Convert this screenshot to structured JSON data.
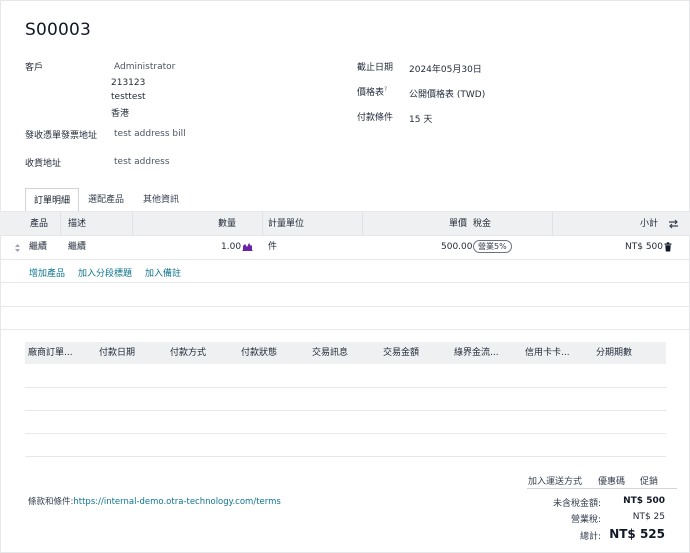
{
  "order": {
    "title": "S00003"
  },
  "customer": {
    "label": "客戶",
    "name": "Administrator",
    "line1": "213123",
    "line2": "testtest",
    "line3": "香港"
  },
  "invoice_address": {
    "label": "發收憑單發票地址",
    "value": "test address bill"
  },
  "delivery_address": {
    "label": "收貨地址",
    "value": "test address"
  },
  "expiration": {
    "label": "截止日期",
    "value": "2024年05月30日"
  },
  "pricelist": {
    "label": "價格表",
    "help": "?",
    "value": "公開價格表 (TWD)"
  },
  "payment_terms": {
    "label": "付款條件",
    "value": "15 天"
  },
  "tabs": [
    {
      "label": "訂單明細",
      "active": true
    },
    {
      "label": "選配產品",
      "active": false
    },
    {
      "label": "其他資訊",
      "active": false
    }
  ],
  "lines_table": {
    "headers": {
      "product": "產品",
      "description": "描述",
      "quantity": "數量",
      "uom": "計量單位",
      "unit_price": "單價",
      "taxes": "稅金",
      "subtotal": "小計"
    },
    "rows": [
      {
        "product": "繼續",
        "description": "繼續",
        "quantity": "1.00",
        "uom": "件",
        "unit_price": "500.00",
        "tax": "營業5%",
        "subtotal": "NT$ 500"
      }
    ],
    "actions": {
      "add_product": "增加產品",
      "add_section": "加入分段標題",
      "add_note": "加入備註"
    }
  },
  "payments_table": {
    "headers": [
      "廠商訂單...",
      "付款日期",
      "付款方式",
      "付款狀態",
      "交易訊息",
      "交易金額",
      "綠界金流...",
      "信用卡卡...",
      "分期期數"
    ]
  },
  "footer_actions": {
    "add_shipping": "加入運送方式",
    "coupon": "優惠碼",
    "promotions": "促銷"
  },
  "terms": {
    "label": "條款和條件:",
    "url": "https://internal-demo.otra-technology.com/terms"
  },
  "totals": {
    "untaxed_label": "未含稅金額:",
    "untaxed_value": "NT$ 500",
    "tax_label": "營業稅:",
    "tax_value": "NT$ 25",
    "total_label": "總計:",
    "total_value": "NT$ 525"
  },
  "colors": {
    "accent": "#0e7490",
    "header_bg": "#eef0f2",
    "border": "#e5e7eb"
  },
  "icons": {
    "drag": "drag-handle-icon",
    "forecast": "bar-chart-icon",
    "delete": "trash-icon",
    "column_settings": "swap-arrows-icon"
  }
}
